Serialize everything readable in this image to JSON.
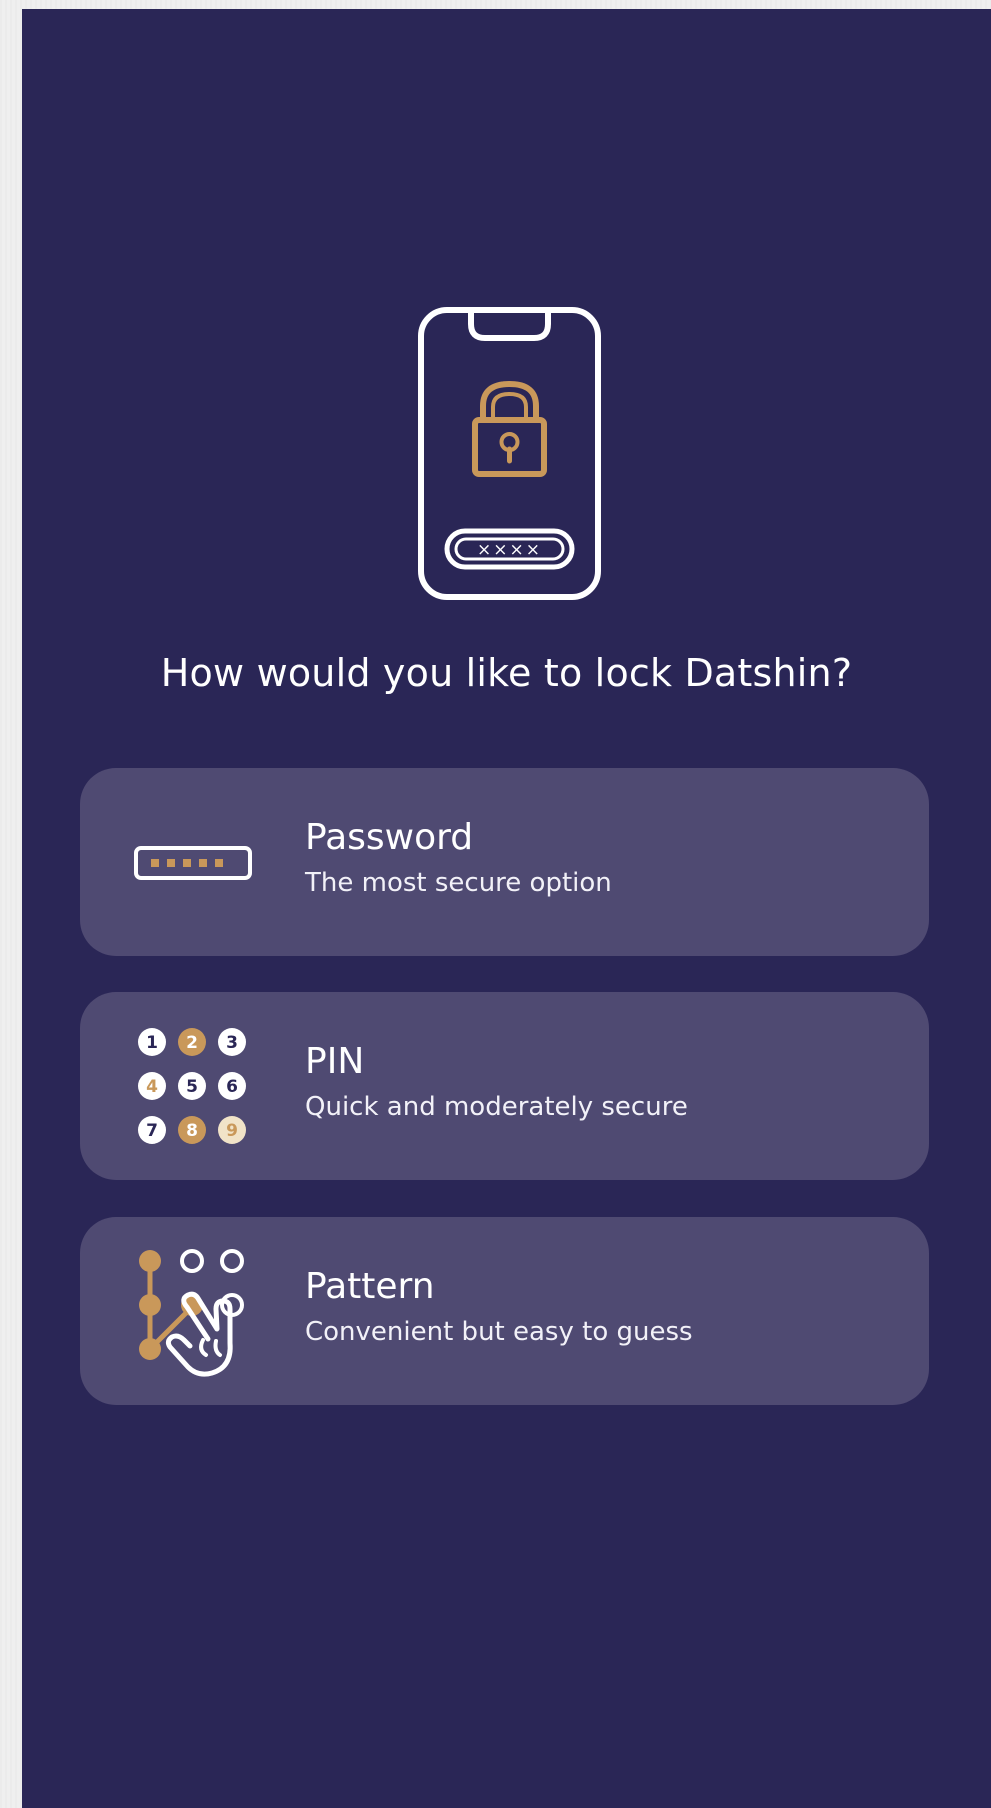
{
  "screen": {
    "title": "How would you like to lock Datshin?",
    "background": "#2a2656"
  },
  "hero": {
    "icon": "phone-lock-icon",
    "pin_mask": "××××"
  },
  "options": [
    {
      "id": "password",
      "label": "Password",
      "description": "The most secure option",
      "icon": "password-field-icon"
    },
    {
      "id": "pin",
      "label": "PIN",
      "description": "Quick and moderately secure",
      "icon": "pin-keypad-icon",
      "digits": [
        "1",
        "2",
        "3",
        "4",
        "5",
        "6",
        "7",
        "8",
        "9"
      ]
    },
    {
      "id": "pattern",
      "label": "Pattern",
      "description": "Convenient but easy to guess",
      "icon": "pattern-gesture-icon"
    }
  ],
  "colors": {
    "accent_gold": "#c9985a",
    "card": "#4f4a72",
    "text": "#ffffff"
  }
}
